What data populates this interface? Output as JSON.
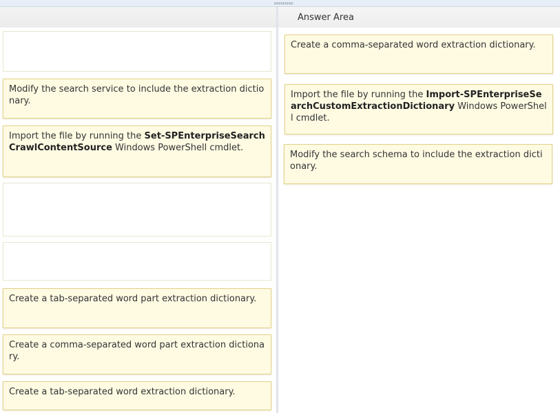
{
  "answer_area": {
    "title": "Answer Area"
  },
  "source_cards": [
    {
      "text": "Modify the search service to include the extraction dictionary."
    },
    {
      "prefix": "Import the file by running the ",
      "bold": "Set-SPEnterpriseSearchCrawlContentSource",
      "suffix": " Windows PowerShell cmdlet."
    },
    {
      "text": "Create a tab-separated word part extraction dictionary."
    },
    {
      "text": "Create a comma-separated word part extraction dictionary."
    },
    {
      "text": "Create a tab-separated word extraction dictionary."
    }
  ],
  "answer_cards": [
    {
      "text": "Create a comma-separated word extraction dictionary."
    },
    {
      "prefix": "Import the file by running the ",
      "bold": "Import-SPEnterpriseSearchCustomExtractionDictionary",
      "suffix": " Windows PowerShell cmdlet."
    },
    {
      "text": "Modify the search schema to include the extraction dictionary."
    }
  ]
}
